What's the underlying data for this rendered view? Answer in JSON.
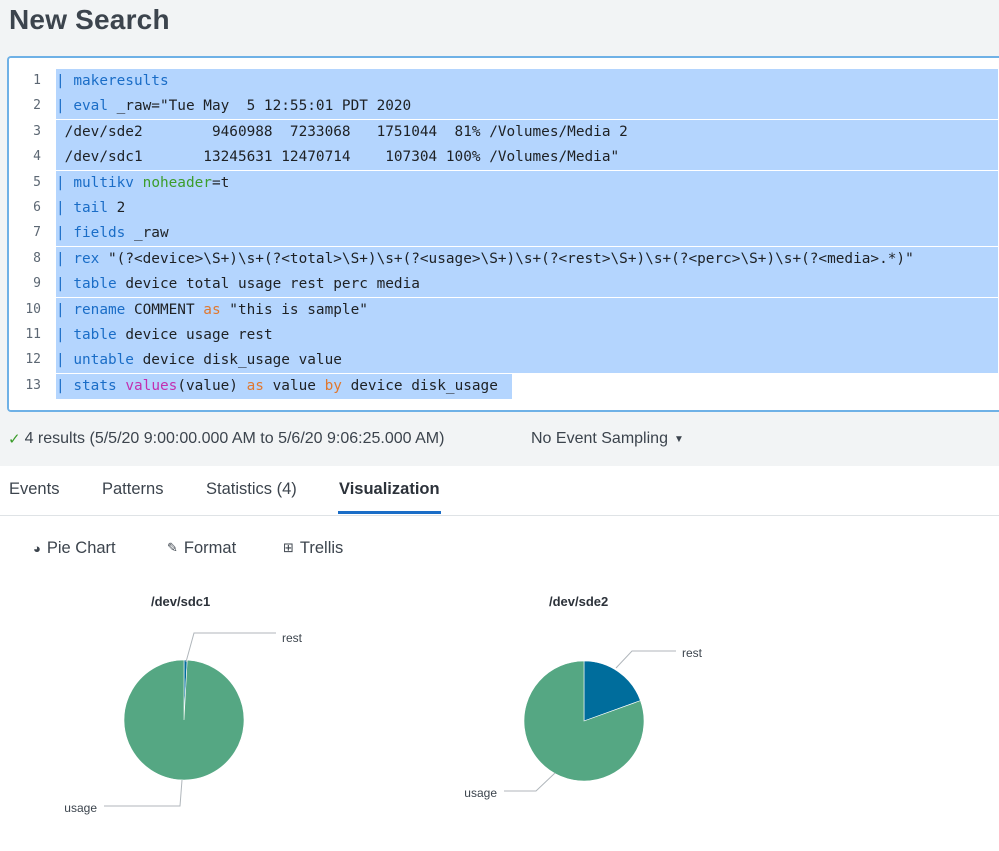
{
  "page": {
    "title": "New Search"
  },
  "editor": {
    "line_numbers": [
      "1",
      "2",
      "3",
      "4",
      "5",
      "6",
      "7",
      "8",
      "9",
      "10",
      "11",
      "12",
      "13"
    ],
    "lines": [
      [
        {
          "t": "| ",
          "c": "pipe"
        },
        {
          "t": "makeresults",
          "c": "kw"
        }
      ],
      [
        {
          "t": "| ",
          "c": "pipe"
        },
        {
          "t": "eval",
          "c": "kw"
        },
        {
          "t": " _raw=\"Tue May  5 12:55:01 PDT 2020",
          "c": "str"
        }
      ],
      [
        {
          "t": " /dev/sde2        9460988  7233068   1751044  81% /Volumes/Media 2",
          "c": "str"
        }
      ],
      [
        {
          "t": " /dev/sdc1       13245631 12470714    107304 100% /Volumes/Media\"",
          "c": "str"
        }
      ],
      [
        {
          "t": "| ",
          "c": "pipe"
        },
        {
          "t": "multikv",
          "c": "kw"
        },
        {
          "t": " ",
          "c": "str"
        },
        {
          "t": "noheader",
          "c": "arg"
        },
        {
          "t": "=t",
          "c": "str"
        }
      ],
      [
        {
          "t": "| ",
          "c": "pipe"
        },
        {
          "t": "tail",
          "c": "kw"
        },
        {
          "t": " 2",
          "c": "str"
        }
      ],
      [
        {
          "t": "| ",
          "c": "pipe"
        },
        {
          "t": "fields",
          "c": "kw"
        },
        {
          "t": " _raw",
          "c": "str"
        }
      ],
      [
        {
          "t": "| ",
          "c": "pipe"
        },
        {
          "t": "rex",
          "c": "kw"
        },
        {
          "t": " \"(?<device>\\S+)\\s+(?<total>\\S+)\\s+(?<usage>\\S+)\\s+(?<rest>\\S+)\\s+(?<perc>\\S+)\\s+(?<media>.*)\"",
          "c": "str"
        }
      ],
      [
        {
          "t": "| ",
          "c": "pipe"
        },
        {
          "t": "table",
          "c": "kw"
        },
        {
          "t": " device total usage rest perc media",
          "c": "str"
        }
      ],
      [
        {
          "t": "| ",
          "c": "pipe"
        },
        {
          "t": "rename",
          "c": "kw"
        },
        {
          "t": " COMMENT ",
          "c": "str"
        },
        {
          "t": "as",
          "c": "op"
        },
        {
          "t": " \"this is sample\"",
          "c": "str"
        }
      ],
      [
        {
          "t": "| ",
          "c": "pipe"
        },
        {
          "t": "table",
          "c": "kw"
        },
        {
          "t": " device usage rest",
          "c": "str"
        }
      ],
      [
        {
          "t": "| ",
          "c": "pipe"
        },
        {
          "t": "untable",
          "c": "kw"
        },
        {
          "t": " device disk_usage value",
          "c": "str"
        }
      ],
      [
        {
          "t": "| ",
          "c": "pipe"
        },
        {
          "t": "stats",
          "c": "kw"
        },
        {
          "t": " ",
          "c": "str"
        },
        {
          "t": "values",
          "c": "fn"
        },
        {
          "t": "(value) ",
          "c": "str"
        },
        {
          "t": "as",
          "c": "op"
        },
        {
          "t": " value ",
          "c": "str"
        },
        {
          "t": "by",
          "c": "op"
        },
        {
          "t": " device disk_usage",
          "c": "str"
        }
      ]
    ]
  },
  "status": {
    "results_text": "4 results (5/5/20 9:00:00.000 AM to 5/6/20 9:06:25.000 AM)",
    "sampling_label": "No Event Sampling"
  },
  "tabs": [
    {
      "label": "Events"
    },
    {
      "label": "Patterns"
    },
    {
      "label": "Statistics (4)"
    },
    {
      "label": "Visualization"
    }
  ],
  "viz_toolbar": {
    "pie_label": "Pie Chart",
    "format_label": "Format",
    "trellis_label": "Trellis"
  },
  "colors": {
    "usage": "#55a783",
    "rest": "#006d9c",
    "accent": "#1a6dc7",
    "selection": "#b4d5fe"
  },
  "chart_data": [
    {
      "type": "pie",
      "title": "/dev/sdc1",
      "slices": [
        {
          "label": "rest",
          "value": 107304
        },
        {
          "label": "usage",
          "value": 12470714
        }
      ]
    },
    {
      "type": "pie",
      "title": "/dev/sde2",
      "slices": [
        {
          "label": "rest",
          "value": 1751044
        },
        {
          "label": "usage",
          "value": 7233068
        }
      ]
    }
  ]
}
